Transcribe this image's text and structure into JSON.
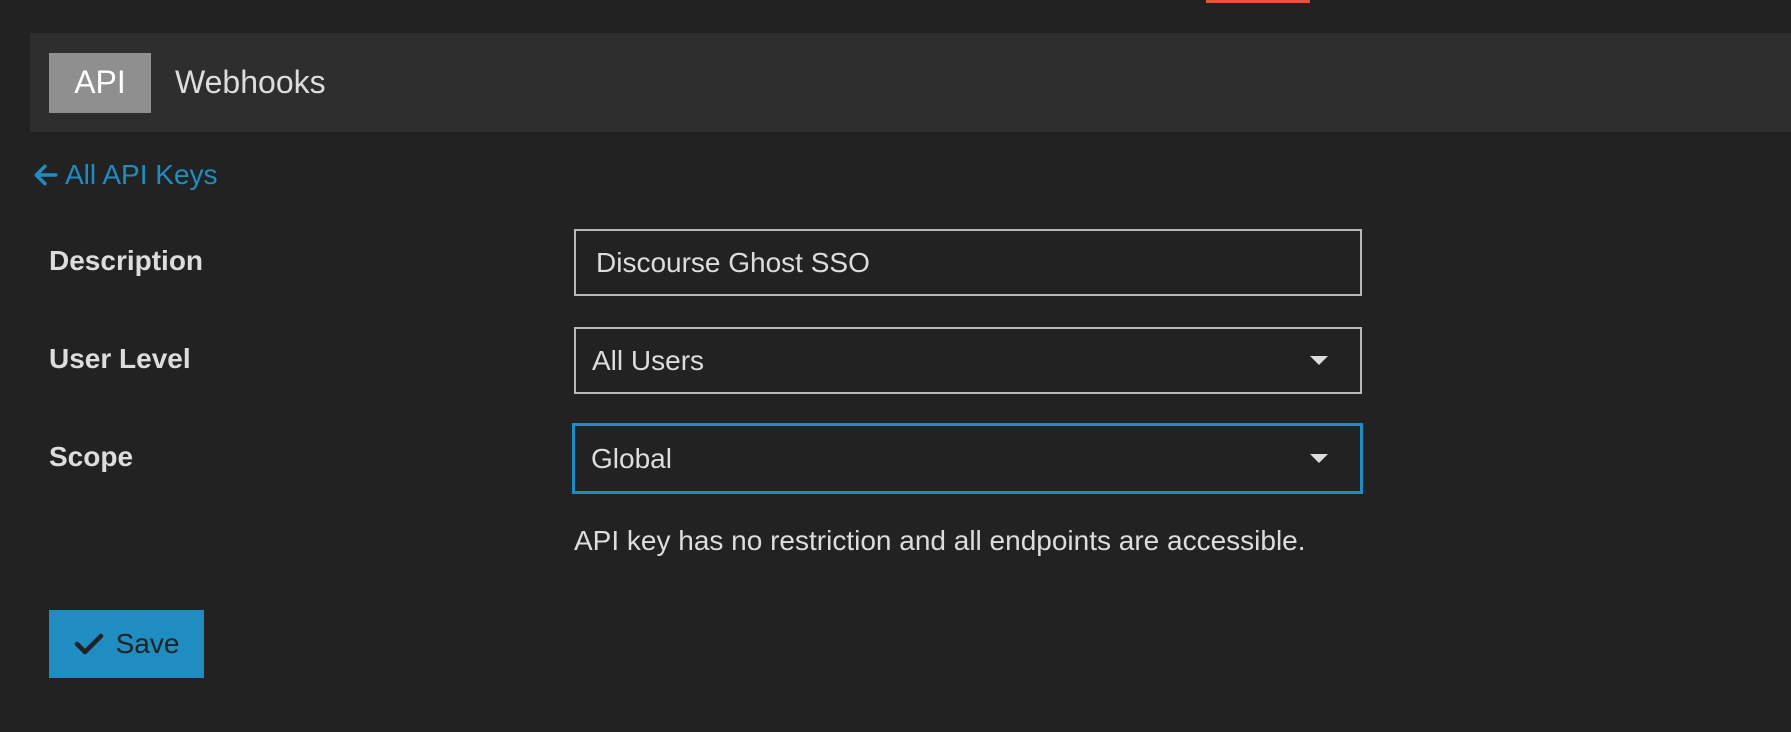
{
  "tabs": [
    {
      "label": "API",
      "active": true
    },
    {
      "label": "Webhooks",
      "active": false
    }
  ],
  "back_link": {
    "label": "All API Keys",
    "icon": "arrow-left-icon"
  },
  "form": {
    "description": {
      "label": "Description",
      "value": "Discourse Ghost SSO"
    },
    "user_level": {
      "label": "User Level",
      "value": "All Users"
    },
    "scope": {
      "label": "Scope",
      "value": "Global"
    },
    "scope_help": "API key has no restriction and all endpoints are accessible."
  },
  "save_button": {
    "label": "Save",
    "icon": "check-icon"
  },
  "colors": {
    "background": "#222222",
    "tabbar": "#2e2e2e",
    "active_tab": "#8f8f8f",
    "accent": "#1f8dc2",
    "top_accent": "#e45735"
  }
}
